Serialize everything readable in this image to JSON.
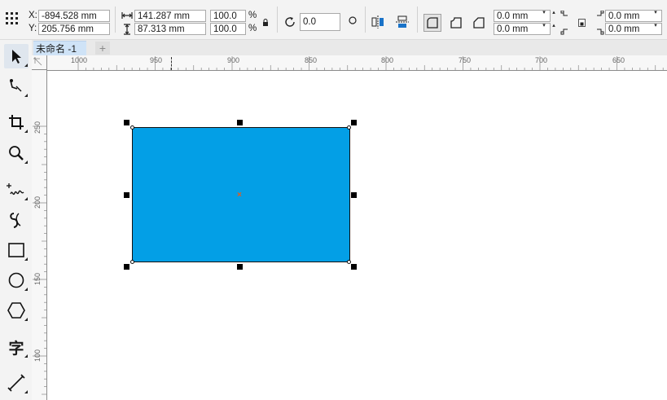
{
  "property_bar": {
    "x_label": "X:",
    "y_label": "Y:",
    "x_value": "-894.528 mm",
    "y_value": "205.756 mm",
    "width_value": "141.287 mm",
    "height_value": "87.313 mm",
    "scale_w": "100.0",
    "scale_h": "100.0",
    "percent": "%",
    "rotation": "0.0",
    "corner_radius_tl": "0.0 mm",
    "corner_radius_bl": "0.0 mm",
    "corner_radius_tr": "0.0 mm",
    "corner_radius_br": "0.0 mm"
  },
  "document": {
    "tab_title": "未命名 -1",
    "add_tab": "+"
  },
  "ruler": {
    "h_labels": [
      "1000",
      "950",
      "900",
      "850",
      "800",
      "750",
      "700",
      "650"
    ],
    "v_labels": [
      "250",
      "200",
      "150",
      "100"
    ]
  },
  "toolbox": {
    "text_tool_glyph": "字"
  },
  "colors": {
    "shape_fill": "#039fe6",
    "center_marker": "#e85a1a"
  }
}
